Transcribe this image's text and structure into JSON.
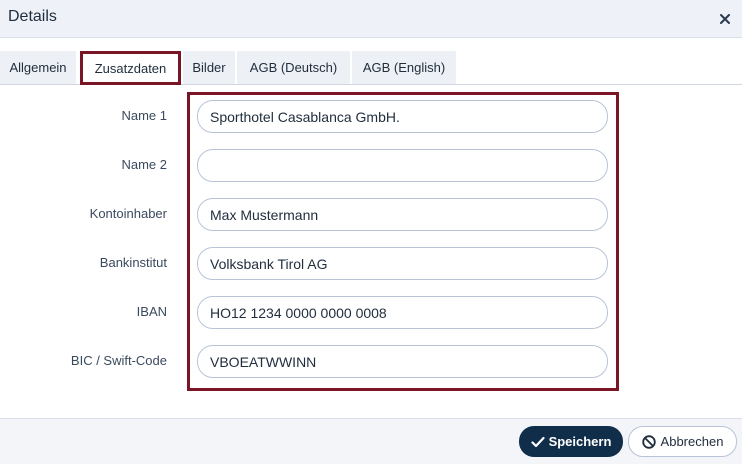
{
  "dialog": {
    "title": "Details",
    "close_icon": "close-icon"
  },
  "tabs": [
    {
      "label": "Allgemein",
      "active": false
    },
    {
      "label": "Zusatzdaten",
      "active": true
    },
    {
      "label": "Bilder",
      "active": false
    },
    {
      "label": "AGB (Deutsch)",
      "active": false
    },
    {
      "label": "AGB (English)",
      "active": false
    }
  ],
  "form": {
    "fields": [
      {
        "label": "Name 1",
        "value": "Sporthotel Casablanca GmbH."
      },
      {
        "label": "Name 2",
        "value": ""
      },
      {
        "label": "Kontoinhaber",
        "value": "Max Mustermann"
      },
      {
        "label": "Bankinstitut",
        "value": "Volksbank Tirol AG"
      },
      {
        "label": "IBAN",
        "value": "HO12 1234 0000 0000 0008"
      },
      {
        "label": "BIC / Swift-Code",
        "value": "VBOEATWWINN"
      }
    ]
  },
  "footer": {
    "save_label": "Speichern",
    "cancel_label": "Abbrechen"
  },
  "colors": {
    "highlight": "#7a1526",
    "primary_button": "#102d4a",
    "header_bg": "#eef2f8"
  }
}
